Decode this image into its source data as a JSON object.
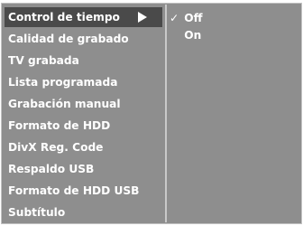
{
  "menu": {
    "items": [
      {
        "label": "Control de tiempo"
      },
      {
        "label": "Calidad de grabado"
      },
      {
        "label": "TV grabada"
      },
      {
        "label": "Lista programada"
      },
      {
        "label": "Grabación manual"
      },
      {
        "label": "Formato de HDD"
      },
      {
        "label": "DivX Reg. Code"
      },
      {
        "label": "Respaldo USB"
      },
      {
        "label": "Formato de HDD USB"
      },
      {
        "label": "Subtítulo"
      }
    ],
    "selected_item": "Control de tiempo",
    "submenu_arrow_icon": "triangle-right-icon"
  },
  "submenu": {
    "options": [
      {
        "label": "Off",
        "check": "✓",
        "checked": true
      },
      {
        "label": "On",
        "check": "",
        "checked": false
      }
    ],
    "check_icon": "checkmark-icon"
  },
  "colors": {
    "panel_background": "#8e8e8e",
    "selected_background": "#4a4a4a",
    "divider": "#c9c9c9",
    "text": "#ffffff"
  }
}
